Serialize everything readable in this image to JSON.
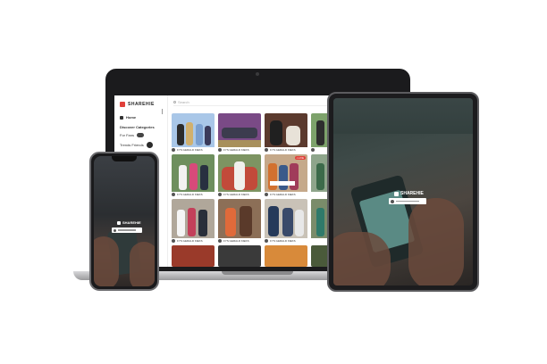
{
  "app": {
    "brand": "SHAREHIE",
    "search_placeholder": "Search",
    "sidebar": {
      "items": [
        {
          "label": "Home"
        },
        {
          "label": "Discover Categories"
        },
        {
          "label": "For Fans"
        },
        {
          "label": "Trends Friends"
        }
      ]
    },
    "tiles": [
      {
        "caption": "FYS GERALD KIEKS",
        "color": "#a9c7e8"
      },
      {
        "caption": "FYS GERALD KIEKS",
        "color": "#7a4a86"
      },
      {
        "caption": "FYS GERALD KIEKS",
        "color": "#5b3a2e"
      },
      {
        "caption": "FYS GERALD KIEKS",
        "color": "#7da26b"
      },
      {
        "caption": "FYS GERALD KIEKS",
        "color": "#6e8f5e"
      },
      {
        "caption": "FYS GERALD KIEKS",
        "color": "#7d9462"
      },
      {
        "caption": "FYS GERALD KIEKS",
        "color": "#c5a98a",
        "badge": "• LIVE"
      },
      {
        "caption": "FYS GERALD KIEKS",
        "color": "#8ea58b"
      },
      {
        "caption": "FYS GERALD KIEKS",
        "color": "#b0a79a"
      },
      {
        "caption": "FYS GERALD KIEKS",
        "color": "#8c6f57"
      },
      {
        "caption": "FYS GERALD KIEKS",
        "color": "#c9c2b7"
      },
      {
        "caption": "FYS GERALD KIEKS",
        "color": "#7a8c6a"
      }
    ],
    "phone_card_title": "SHAREHIE",
    "tablet_card_title": "SHAREHIE"
  },
  "colors": {
    "brand_red": "#e0403a",
    "device_dark": "#1b1b1d"
  }
}
